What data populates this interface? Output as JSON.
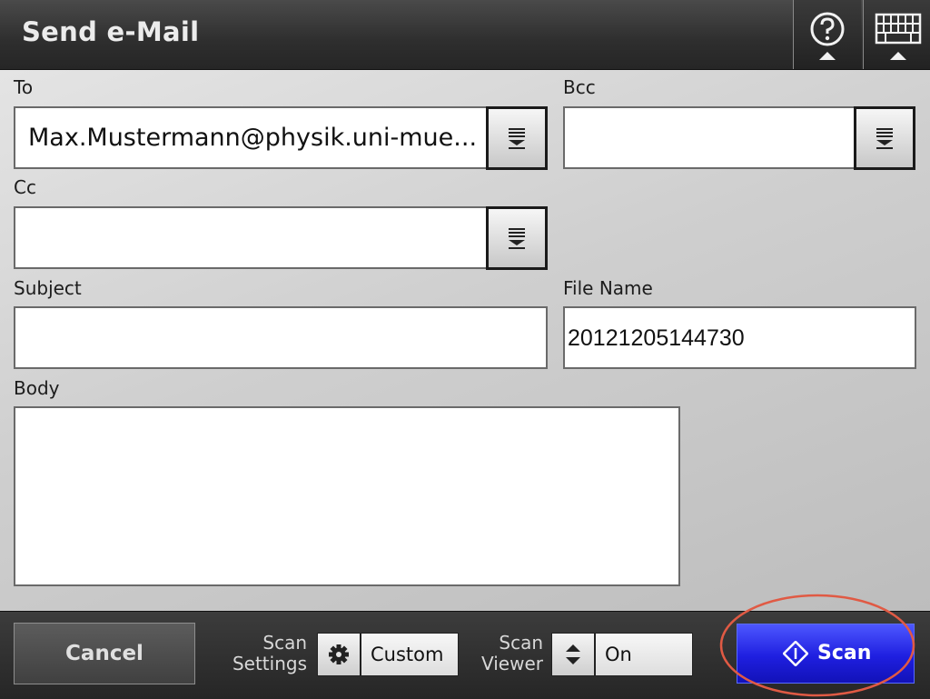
{
  "header": {
    "title": "Send e-Mail",
    "help_icon": "help-icon",
    "keyboard_icon": "keyboard-icon"
  },
  "form": {
    "to": {
      "label": "To",
      "value": "Max.Mustermann@physik.uni-mue..."
    },
    "bcc": {
      "label": "Bcc",
      "value": ""
    },
    "cc": {
      "label": "Cc",
      "value": ""
    },
    "subject": {
      "label": "Subject",
      "value": ""
    },
    "file_name": {
      "label": "File Name",
      "value": "20121205144730"
    },
    "body": {
      "label": "Body",
      "value": ""
    }
  },
  "footer": {
    "cancel_label": "Cancel",
    "scan_settings": {
      "label_line1": "Scan",
      "label_line2": "Settings",
      "value": "Custom",
      "icon": "gear-icon"
    },
    "scan_viewer": {
      "label_line1": "Scan",
      "label_line2": "Viewer",
      "value": "On",
      "icon": "up-down-arrows-icon"
    },
    "scan_label": "Scan",
    "scan_icon": "start-diamond-icon"
  },
  "colors": {
    "header_bg": "#2e2e2e",
    "scan_button": "#1f1fe0",
    "highlight_ring": "#e05a44"
  }
}
